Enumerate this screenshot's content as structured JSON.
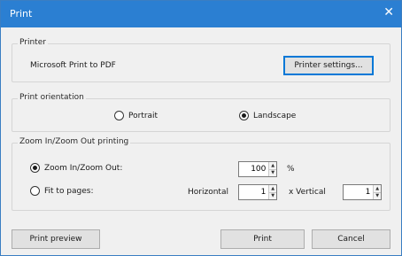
{
  "window": {
    "title": "Print",
    "close_glyph": "✕"
  },
  "printer_group": {
    "legend": "Printer",
    "printer_name": "Microsoft Print to PDF",
    "settings_button": "Printer settings..."
  },
  "orientation_group": {
    "legend": "Print orientation",
    "options": [
      {
        "label": "Portrait",
        "selected": false
      },
      {
        "label": "Landscape",
        "selected": true
      }
    ]
  },
  "zoom_group": {
    "legend": "Zoom In/Zoom Out printing",
    "zoom_option": {
      "label": "Zoom In/Zoom Out:",
      "selected": true
    },
    "fit_option": {
      "label": "Fit to pages:",
      "selected": false
    },
    "zoom_value": "100",
    "zoom_unit": "%",
    "horizontal_label": "Horizontal",
    "horizontal_value": "1",
    "vertical_label": "x Vertical",
    "vertical_value": "1"
  },
  "buttons": {
    "preview": "Print preview",
    "print": "Print",
    "cancel": "Cancel"
  },
  "icons": {
    "spin_up": "▲",
    "spin_down": "▼"
  }
}
